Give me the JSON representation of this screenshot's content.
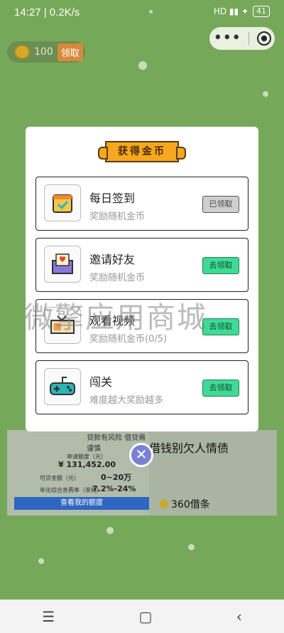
{
  "status": {
    "time": "14:27 | 0.2K/s",
    "icons": "HD ▮▮ ✦",
    "battery": "41"
  },
  "coin_pill": {
    "count": "100",
    "claim": "领取"
  },
  "modal": {
    "title": "获得金币",
    "tasks": [
      {
        "title": "每日签到",
        "subtitle": "奖励随机金币",
        "button": "已领取",
        "icon": "calendar-icon"
      },
      {
        "title": "邀请好友",
        "subtitle": "奖励随机金币",
        "button": "去领取",
        "icon": "envelope-heart-icon"
      },
      {
        "title": "观看视频",
        "subtitle": "奖励随机金币(0/5)",
        "button": "去领取",
        "icon": "video-ticket-icon"
      },
      {
        "title": "闯关",
        "subtitle": "难度越大奖励越多",
        "button": "去领取",
        "icon": "gamepad-icon"
      }
    ]
  },
  "ad": {
    "title": "借钱别欠人情债",
    "sub": "360借条",
    "risk": "贷款有风险 借贷需谨慎",
    "amount_label": "申请额度（元）",
    "amount": "¥ 131,452.00",
    "range_label": "可贷金额（元）",
    "range": "0~20万",
    "rate_label": "年化综合息费率（单利）",
    "rate": "7.2%-24%",
    "button": "查看我的额度"
  },
  "watermark": "微擎应用商城",
  "navbar": {
    "menu": "☰",
    "home": "▢",
    "back": "‹"
  }
}
